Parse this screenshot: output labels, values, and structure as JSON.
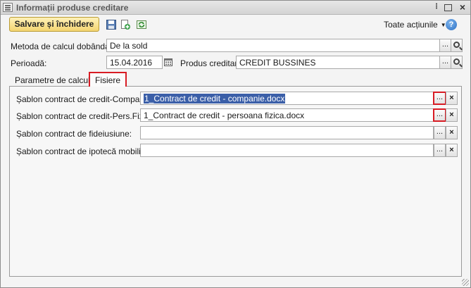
{
  "window": {
    "title": "Informații produse creditare",
    "more_glyph": "⋮",
    "close_glyph": "×"
  },
  "toolbar": {
    "save_close_label": "Salvare și închidere",
    "save_icon": "floppy-disk-icon",
    "save_copy_icon": "save-copy-icon",
    "refresh_icon": "refresh-icon",
    "actions_label": "Toate acțiunile",
    "actions_caret": "▼",
    "help_label": "?"
  },
  "form": {
    "interest_method_label": "Metoda de calcul dobânda:",
    "interest_method_value": "De la sold",
    "period_label": "Perioadă:",
    "period_value": "15.04.2016",
    "credit_product_label": "Produs creditar:",
    "credit_product_value": "CREDIT BUSSINES",
    "browse_label": "...",
    "clear_label": "×"
  },
  "tabs": [
    {
      "label": "Parametre de calcul",
      "active": false
    },
    {
      "label": "Fisiere",
      "active": true
    }
  ],
  "files": [
    {
      "label": "Șablon contract de credit-Companie:",
      "value": "1_Contract de credit - companie.docx",
      "selected": true
    },
    {
      "label": "Șablon contract de credit-Pers.Fizice:",
      "value": "1_Contract de credit - persoana fizica.docx",
      "selected": false
    },
    {
      "label": "Șablon contract de fideiusiune:",
      "value": "",
      "selected": false
    },
    {
      "label": "Șablon contract de ipotecă mobiliară:",
      "value": "",
      "selected": false
    }
  ],
  "colors": {
    "highlight_border": "#d81c24",
    "save_button": "#f4d572",
    "selection": "#3b5fa8"
  }
}
